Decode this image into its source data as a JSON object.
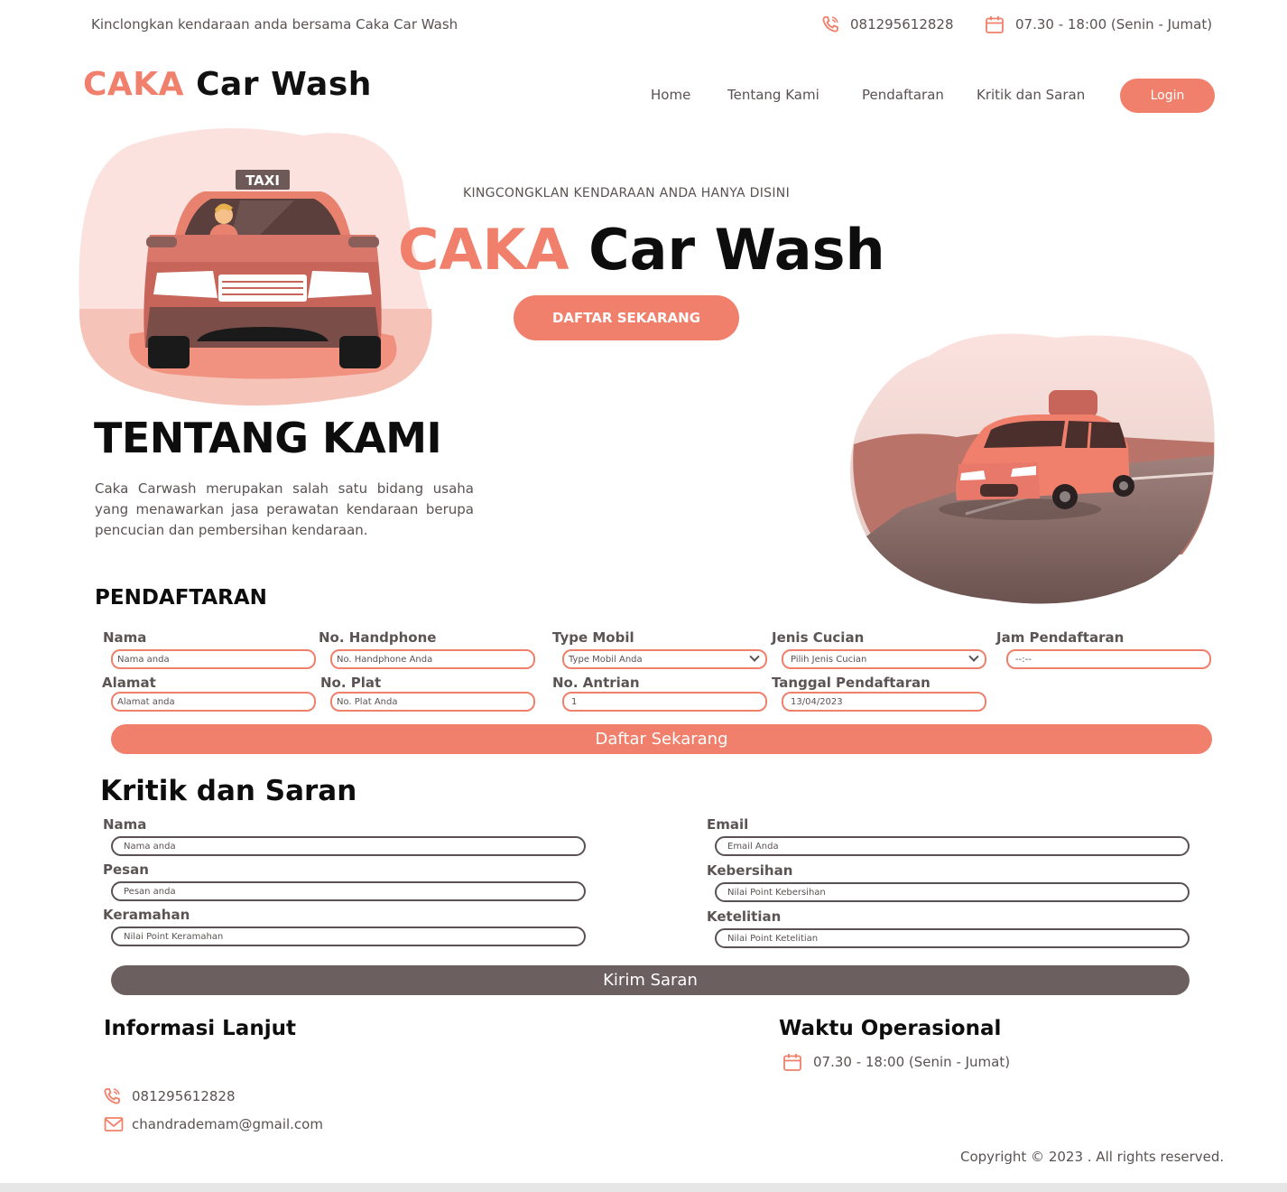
{
  "topbar": {
    "tagline": "Kinclongkan kendaraan anda bersama Caka Car Wash",
    "phone": "081295612828",
    "hours": "07.30 - 18:00 (Senin - Jumat)"
  },
  "header": {
    "logo_accent": "CAKA",
    "logo_rest": "Car Wash",
    "nav": [
      "Home",
      "Tentang Kami",
      "Pendaftaran",
      "Kritik dan Saran"
    ],
    "login": "Login"
  },
  "hero": {
    "subtitle": "KINGCONGKLAN KENDARAAN ANDA HANYA DISINI",
    "title_accent": "CAKA",
    "title_rest": "Car Wash",
    "cta": "DAFTAR SEKARANG"
  },
  "about": {
    "title": "TENTANG KAMI",
    "text": "Caka Carwash merupakan salah satu bidang usaha yang menawarkan jasa perawatan kendaraan berupa pencucian dan pembersihan kendaraan."
  },
  "registration": {
    "title": "PENDAFTARAN",
    "fields": {
      "nama": {
        "label": "Nama",
        "placeholder": "Nama anda"
      },
      "hp": {
        "label": "No. Handphone",
        "placeholder": "No. Handphone Anda"
      },
      "type": {
        "label": "Type Mobil",
        "placeholder": "Type Mobil Anda"
      },
      "jenis": {
        "label": "Jenis Cucian",
        "placeholder": "Pilih Jenis Cucian"
      },
      "jam": {
        "label": "Jam Pendaftaran",
        "placeholder": "--:--"
      },
      "alamat": {
        "label": "Alamat",
        "placeholder": "Alamat anda"
      },
      "plat": {
        "label": "No. Plat",
        "placeholder": "No. Plat Anda"
      },
      "antrian": {
        "label": "No. Antrian",
        "value": "1"
      },
      "tanggal": {
        "label": "Tanggal Pendaftaran",
        "value": "13/04/2023"
      }
    },
    "submit": "Daftar Sekarang"
  },
  "feedback": {
    "title": "Kritik dan Saran",
    "fields": {
      "nama": {
        "label": "Nama",
        "placeholder": "Nama anda"
      },
      "pesan": {
        "label": "Pesan",
        "placeholder": "Pesan anda"
      },
      "keramahan": {
        "label": "Keramahan",
        "placeholder": "Nilai Point Keramahan"
      },
      "email": {
        "label": "Email",
        "placeholder": "Email Anda"
      },
      "kebersihan": {
        "label": "Kebersihan",
        "placeholder": "Nilai Point Kebersihan"
      },
      "ketelitian": {
        "label": "Ketelitian",
        "placeholder": "Nilai Point Ketelitian"
      }
    },
    "submit": "Kirim Saran"
  },
  "footer": {
    "info_title": "Informasi Lanjut",
    "phone": "081295612828",
    "email": "chandrademam@gmail.com",
    "hours_title": "Waktu Operasional",
    "hours": "07.30 - 18:00 (Senin - Jumat)",
    "copyright": "Copyright © 2023 . All rights reserved."
  },
  "illustration": {
    "taxi_sign": "TAXI"
  },
  "colors": {
    "accent": "#f0806b",
    "dark_button": "#6b5f5f",
    "text": "#5a5252"
  },
  "icons": [
    "phone-icon",
    "calendar-icon",
    "mail-icon",
    "chevron-down-icon"
  ]
}
